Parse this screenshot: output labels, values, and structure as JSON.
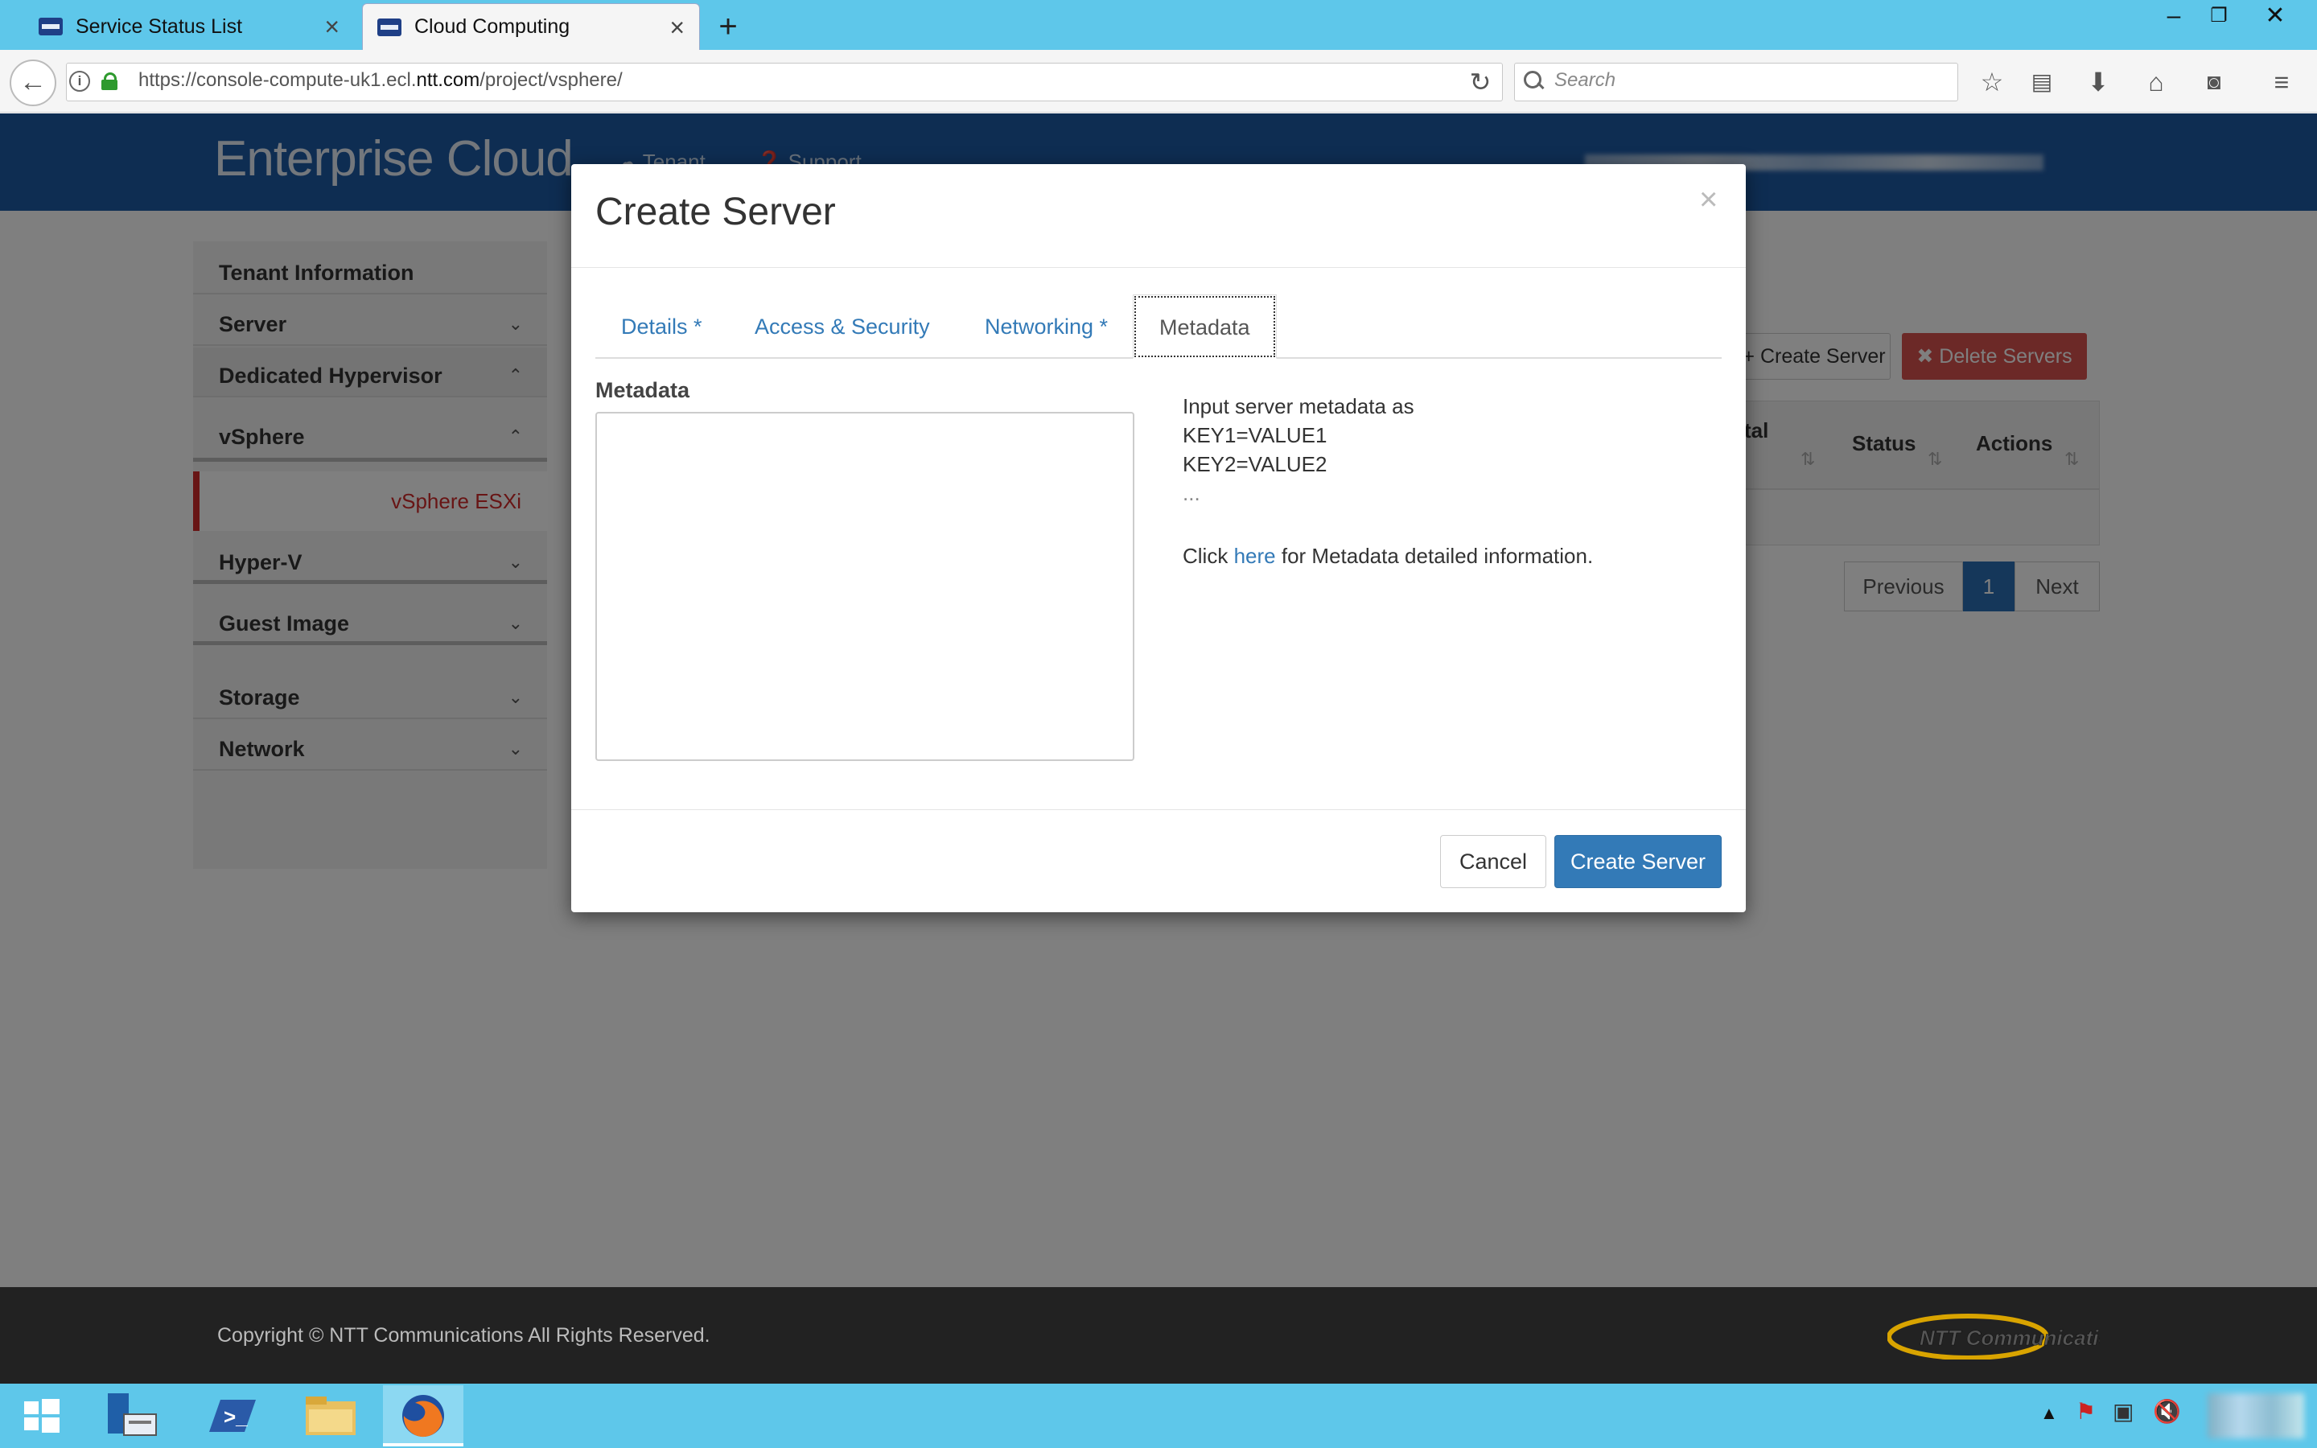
{
  "browser": {
    "tabs": [
      {
        "label": "Service Status List",
        "active": false
      },
      {
        "label": "Cloud Computing",
        "active": true
      }
    ],
    "url_prefix": "https://console-compute-uk1.ecl.",
    "url_domain": "ntt.com",
    "url_suffix": "/project/vsphere/",
    "search_placeholder": "Search"
  },
  "header": {
    "brand": "Enterprise Cloud",
    "tenant_label": "Tenant",
    "support_label": "Support"
  },
  "sidebar": {
    "items": [
      {
        "label": "Tenant Information"
      },
      {
        "label": "Server"
      },
      {
        "label": "Dedicated Hypervisor"
      },
      {
        "label": "vSphere"
      },
      {
        "label": "vSphere ESXi"
      },
      {
        "label": "Hyper-V"
      },
      {
        "label": "Guest Image"
      },
      {
        "label": "Storage"
      },
      {
        "label": "Network"
      }
    ]
  },
  "page": {
    "create_server_label": "+ Create Server",
    "delete_servers_label": "✖ Delete Servers",
    "table_headers": [
      "tal",
      "Status",
      "Actions"
    ],
    "pagination": {
      "previous": "Previous",
      "current": "1",
      "next": "Next"
    }
  },
  "modal": {
    "title": "Create Server",
    "close": "×",
    "tabs": [
      {
        "label": "Details *",
        "active": false
      },
      {
        "label": "Access & Security",
        "active": false
      },
      {
        "label": "Networking *",
        "active": false
      },
      {
        "label": "Metadata",
        "active": true
      }
    ],
    "metadata_label": "Metadata",
    "metadata_value": "",
    "help": {
      "line1": "Input server metadata as",
      "line2": "KEY1=VALUE1",
      "line3": "KEY2=VALUE2",
      "line4": "...",
      "click_prefix": "Click",
      "link_text": "here",
      "click_suffix": "for Metadata detailed information."
    },
    "cancel_label": "Cancel",
    "submit_label": "Create Server"
  },
  "footer": {
    "copyright": "Copyright © NTT Communications All Rights Reserved.",
    "logo_text": "NTT Communications"
  },
  "colors": {
    "header_blue": "#1d5aa5",
    "primary": "#337ab7",
    "danger": "#d9534f",
    "active_nav": "#d12b2b",
    "taskbar": "#5ec7ea"
  }
}
